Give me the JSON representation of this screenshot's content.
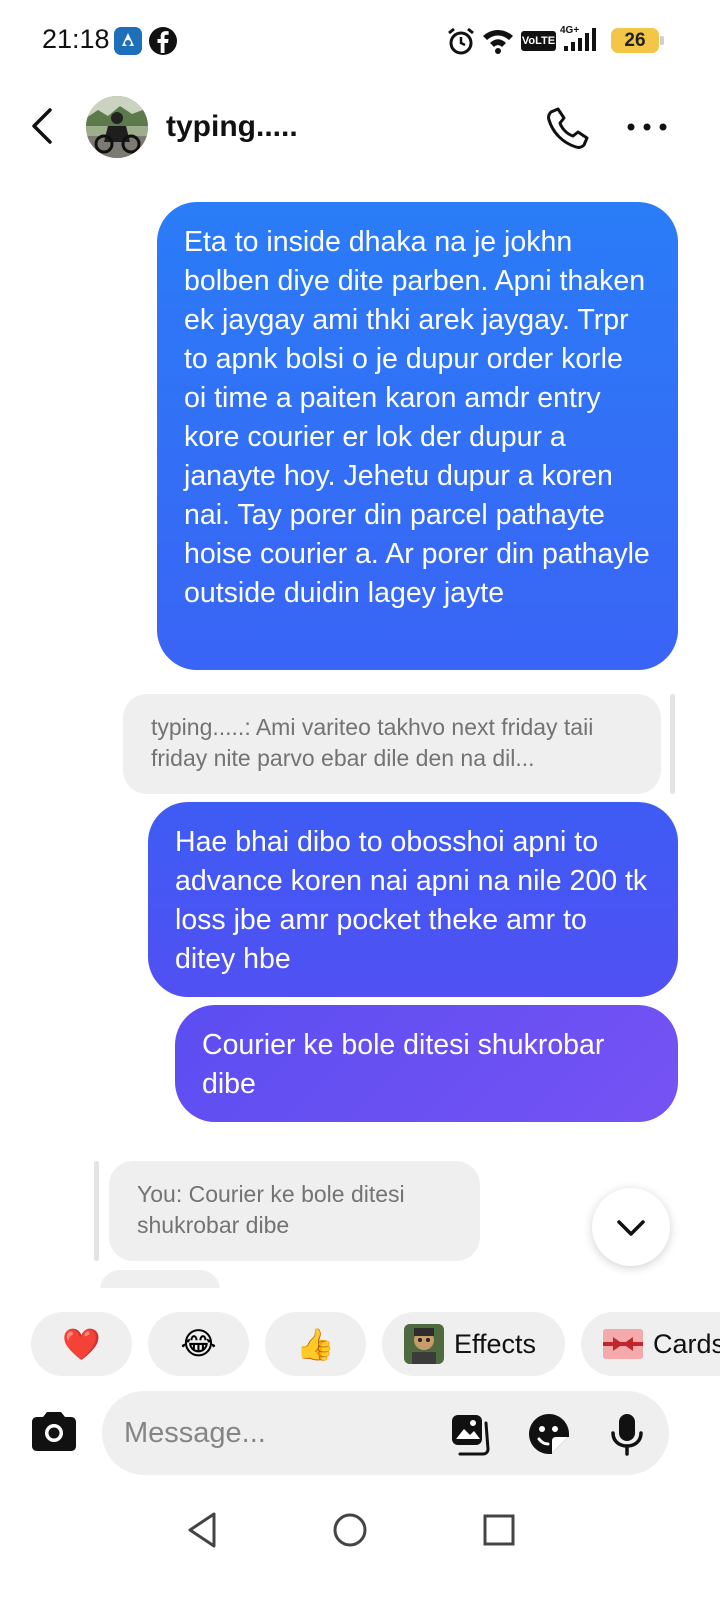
{
  "status_bar": {
    "time": "21:18",
    "network_label": "VoLTE",
    "signal_label": "4G+",
    "battery": "26",
    "icons": [
      "app-notification-icon",
      "facebook-icon",
      "alarm-icon",
      "wifi-icon",
      "volte-icon",
      "signal-icon",
      "battery-icon"
    ]
  },
  "header": {
    "contact_name": "typing.....",
    "icons": [
      "back-arrow-icon",
      "phone-icon",
      "more-icon"
    ]
  },
  "messages": [
    {
      "direction": "outgoing",
      "text": "Eta to inside dhaka na je jokhn bolben diye dite parben. Apni thaken ek jaygay ami thki arek jaygay. Trpr to apnk bolsi o je dupur order korle oi time a paiten karon amdr entry kore courier er lok der dupur a janayte hoy. Jehetu dupur a koren nai. Tay porer din parcel pathayte hoise courier a. Ar porer din pathayle outside duidin lagey jayte"
    },
    {
      "direction": "reply-preview",
      "text": "typing.....: Ami variteo takhvo next friday taii friday nite parvo ebar dile den na dil..."
    },
    {
      "direction": "outgoing",
      "text": "Hae bhai dibo to obosshoi apni to advance koren nai apni na nile 200 tk loss jbe amr pocket theke amr to ditey hbe"
    },
    {
      "direction": "outgoing",
      "text": "Courier ke bole ditesi shukrobar dibe"
    },
    {
      "direction": "reply-preview",
      "text": "You: Courier ke bole ditesi shukrobar dibe"
    }
  ],
  "quick_reactions": [
    {
      "emoji": "❤️",
      "icon": "heart-icon"
    },
    {
      "emoji": "😂",
      "icon": "laughing-icon"
    },
    {
      "emoji": "👍",
      "icon": "thumbs-up-icon"
    },
    {
      "label": "Effects",
      "icon": "effects-thumbnail"
    },
    {
      "label": "Cards",
      "icon": "cards-thumbnail"
    }
  ],
  "composer": {
    "placeholder": "Message...",
    "value": "",
    "icons": [
      "camera-icon",
      "gallery-icon",
      "sticker-icon",
      "microphone-icon"
    ]
  },
  "nav_bar": {
    "icons": [
      "nav-back-icon",
      "nav-home-icon",
      "nav-recents-icon"
    ]
  },
  "colors": {
    "outgoing_top": "#2a7cf7",
    "outgoing_mid": "#3d5cf4",
    "outgoing_bottom": "#7652f3",
    "incoming_bg": "#efefef",
    "battery": "#f3c648"
  }
}
